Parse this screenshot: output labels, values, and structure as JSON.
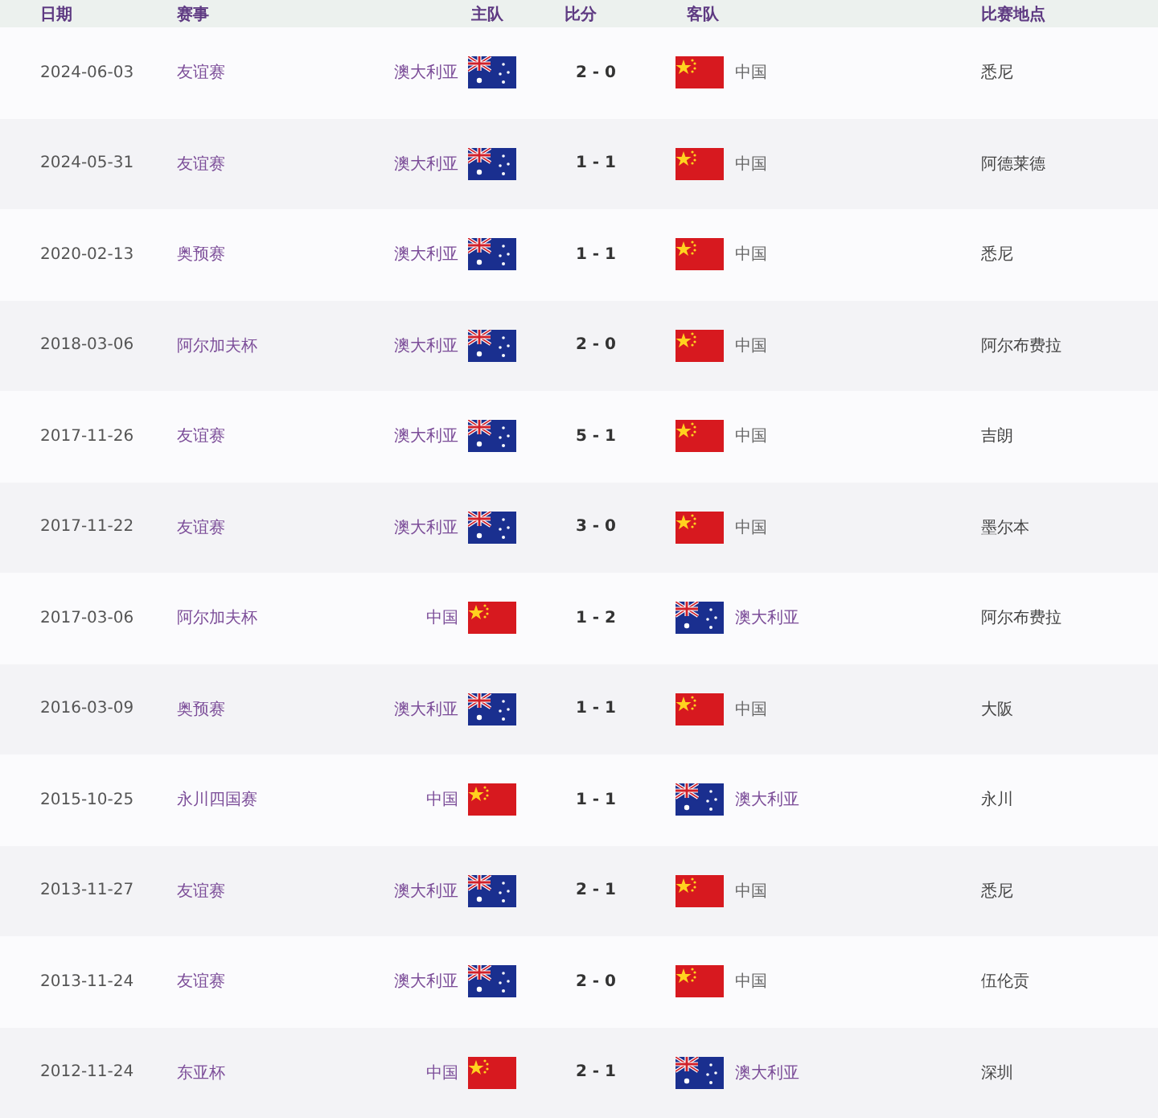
{
  "table": {
    "columns": [
      "日期",
      "赛事",
      "主队",
      "比分",
      "客队",
      "比赛地点"
    ],
    "rows": [
      {
        "date": "2024-06-03",
        "competition": "友谊赛",
        "home": {
          "name": "澳大利亚",
          "kind": "australia"
        },
        "score": "2 - 0",
        "away": {
          "name": "中国",
          "kind": "china"
        },
        "venue": "悉尼"
      },
      {
        "date": "2024-05-31",
        "competition": "友谊赛",
        "home": {
          "name": "澳大利亚",
          "kind": "australia"
        },
        "score": "1 - 1",
        "away": {
          "name": "中国",
          "kind": "china"
        },
        "venue": "阿德莱德"
      },
      {
        "date": "2020-02-13",
        "competition": "奥预赛",
        "home": {
          "name": "澳大利亚",
          "kind": "australia"
        },
        "score": "1 - 1",
        "away": {
          "name": "中国",
          "kind": "china"
        },
        "venue": "悉尼"
      },
      {
        "date": "2018-03-06",
        "competition": "阿尔加夫杯",
        "home": {
          "name": "澳大利亚",
          "kind": "australia"
        },
        "score": "2 - 0",
        "away": {
          "name": "中国",
          "kind": "china"
        },
        "venue": "阿尔布费拉"
      },
      {
        "date": "2017-11-26",
        "competition": "友谊赛",
        "home": {
          "name": "澳大利亚",
          "kind": "australia"
        },
        "score": "5 - 1",
        "away": {
          "name": "中国",
          "kind": "china"
        },
        "venue": "吉朗"
      },
      {
        "date": "2017-11-22",
        "competition": "友谊赛",
        "home": {
          "name": "澳大利亚",
          "kind": "australia"
        },
        "score": "3 - 0",
        "away": {
          "name": "中国",
          "kind": "china"
        },
        "venue": "墨尔本"
      },
      {
        "date": "2017-03-06",
        "competition": "阿尔加夫杯",
        "home": {
          "name": "中国",
          "kind": "china"
        },
        "score": "1 - 2",
        "away": {
          "name": "澳大利亚",
          "kind": "australia"
        },
        "venue": "阿尔布费拉"
      },
      {
        "date": "2016-03-09",
        "competition": "奥预赛",
        "home": {
          "name": "澳大利亚",
          "kind": "australia"
        },
        "score": "1 - 1",
        "away": {
          "name": "中国",
          "kind": "china"
        },
        "venue": "大阪"
      },
      {
        "date": "2015-10-25",
        "competition": "永川四国赛",
        "home": {
          "name": "中国",
          "kind": "china"
        },
        "score": "1 - 1",
        "away": {
          "name": "澳大利亚",
          "kind": "australia"
        },
        "venue": "永川"
      },
      {
        "date": "2013-11-27",
        "competition": "友谊赛",
        "home": {
          "name": "澳大利亚",
          "kind": "australia"
        },
        "score": "2 - 1",
        "away": {
          "name": "中国",
          "kind": "china"
        },
        "venue": "悉尼"
      },
      {
        "date": "2013-11-24",
        "competition": "友谊赛",
        "home": {
          "name": "澳大利亚",
          "kind": "australia"
        },
        "score": "2 - 0",
        "away": {
          "name": "中国",
          "kind": "china"
        },
        "venue": "伍伦贡"
      },
      {
        "date": "2012-11-24",
        "competition": "东亚杯",
        "home": {
          "name": "中国",
          "kind": "china"
        },
        "score": "2 - 1",
        "away": {
          "name": "澳大利亚",
          "kind": "australia"
        },
        "venue": "深圳"
      }
    ]
  }
}
